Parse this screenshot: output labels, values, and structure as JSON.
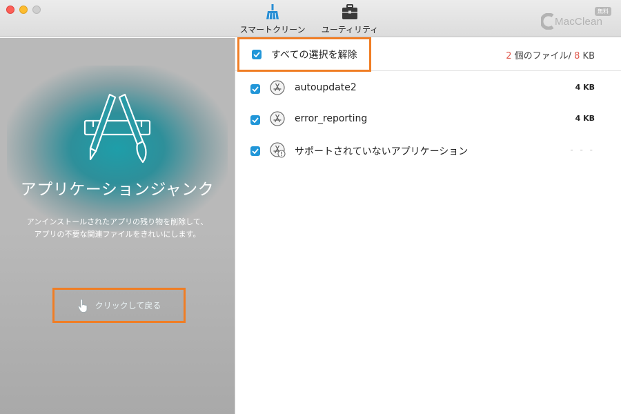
{
  "toolbar": {
    "clean_label": "スマートクリーン",
    "utility_label": "ユーティリティ",
    "brand_name": "MacClean",
    "brand_badge": "無料"
  },
  "left_panel": {
    "title": "アプリケーションジャンク",
    "description_line1": "アンインストールされたアプリの残り物を削除して、",
    "description_line2": "アプリの不要な関連ファイルをきれいにします。",
    "back_label": "クリックして戻る"
  },
  "right_panel": {
    "select_all_label": "すべての選択を解除",
    "summary": {
      "file_count": "2",
      "files_label": " 個のファイル/ ",
      "size_value": "8",
      "size_unit": " KB"
    },
    "items": [
      {
        "name": "autoupdate2",
        "size": "4 KB",
        "checked": true,
        "icon": "app-store-icon"
      },
      {
        "name": "error_reporting",
        "size": "4 KB",
        "checked": true,
        "icon": "app-store-icon"
      },
      {
        "name": "サポートされていないアプリケーション",
        "size": "- - -",
        "checked": true,
        "icon": "app-store-warning-icon"
      }
    ]
  },
  "colors": {
    "accent_orange": "#f07d24",
    "checkbox_blue": "#2196d8",
    "count_red": "#e05a4e",
    "teal_glow": "#1e9ea9"
  }
}
